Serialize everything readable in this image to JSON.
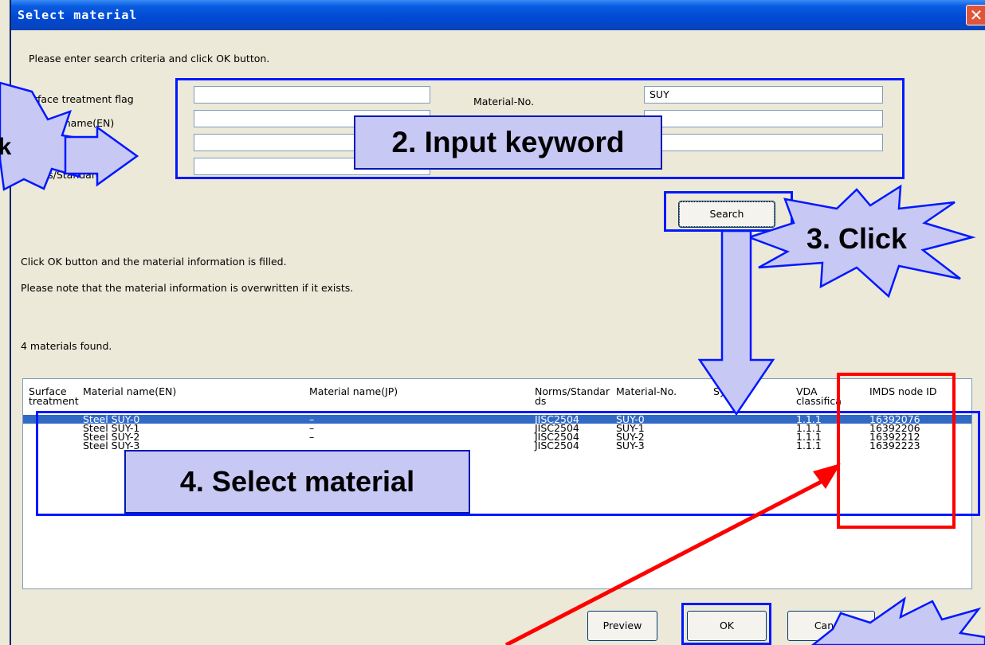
{
  "window": {
    "title": "Select material",
    "close_glyph": "✕"
  },
  "instructions": "Please enter search criteria and click OK button.",
  "form": {
    "surface_treatment_label": "Surface treatment flag",
    "material_name_en_label": "Material name(EN)",
    "norms_label": "Norms/Standards",
    "material_no_label": "Material-No.",
    "material_no_value": "SUY",
    "surface_treatment_value": "",
    "material_name_en_value": "",
    "material_name_jp_value": "",
    "norms_value": ""
  },
  "search_button": "Search",
  "info": {
    "line1": "Click OK button and the material information is filled.",
    "line2": "Please note that the material information is overwritten if it exists.",
    "found": "4 materials found."
  },
  "table": {
    "headers": {
      "surface": "Surface treatment",
      "name_en": "Material name(EN)",
      "name_jp": "Material name(JP)",
      "norms": "Norms/Standar ds",
      "material_no": "Material-No.",
      "symbol": "Symbol",
      "vda": "VDA classifica",
      "imds": "IMDS node ID"
    },
    "rows": [
      {
        "name_en": "Steel SUY-0",
        "name_jp": "–",
        "norms": "JISC2504",
        "material_no": "SUY-0",
        "vda": "1.1.1",
        "imds": "16392076"
      },
      {
        "name_en": "Steel SUY-1",
        "name_jp": "–",
        "norms": "JISC2504",
        "material_no": "SUY-1",
        "vda": "1.1.1",
        "imds": "16392206"
      },
      {
        "name_en": "Steel SUY-2",
        "name_jp": "–",
        "norms": "JISC2504",
        "material_no": "SUY-2",
        "vda": "1.1.1",
        "imds": "16392212"
      },
      {
        "name_en": "Steel SUY-3",
        "name_jp": "",
        "norms": "JISC2504",
        "material_no": "SUY-3",
        "vda": "1.1.1",
        "imds": "16392223"
      }
    ]
  },
  "buttons": {
    "preview": "Preview",
    "ok": "OK",
    "cancel": "Cancel"
  },
  "annotations": {
    "step1_fragment": "k",
    "step2": "2. Input keyword",
    "step3": "3. Click",
    "step4": "4. Select material"
  },
  "colors": {
    "title_bar": "#0a43b8",
    "selection": "#316ac5",
    "callout_fill": "#c8c8f5",
    "frame_blue": "#0018ff",
    "frame_red": "#ff0000"
  }
}
